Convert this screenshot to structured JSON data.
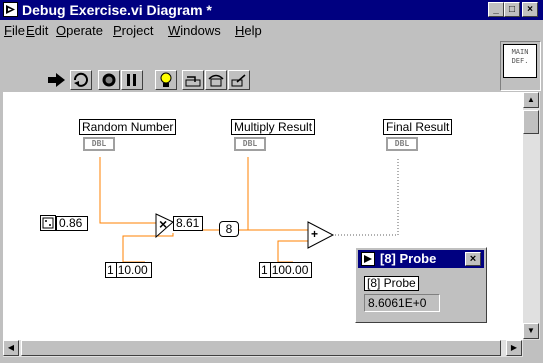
{
  "window": {
    "title": "Debug Exercise.vi Diagram *",
    "controls": {
      "minimize": "_",
      "maximize": "□",
      "close": "×"
    }
  },
  "menu": {
    "items": [
      {
        "label_u": "F",
        "label_rest": "ile"
      },
      {
        "label_u": "E",
        "label_rest": "dit"
      },
      {
        "label_u": "O",
        "label_rest": "perate"
      },
      {
        "label_u": "P",
        "label_rest": "roject"
      },
      {
        "label_u": "W",
        "label_rest": "indows"
      },
      {
        "label_u": "H",
        "label_rest": "elp"
      }
    ]
  },
  "toolbar": {
    "icons": [
      "run-arrow-icon",
      "run-continuously-icon",
      "abort-icon",
      "pause-icon",
      "highlight-execution-icon",
      "step-into-icon",
      "step-over-icon",
      "step-out-icon"
    ]
  },
  "main_icon": {
    "line1": "MAIN",
    "line2": "DEF."
  },
  "diagram": {
    "random_number_label": "Random Number",
    "multiply_result_label": "Multiply Result",
    "final_result_label": "Final Result",
    "dbl_tag": "DBL",
    "random_value": "0.86",
    "multiply_value": "8.61",
    "probe_tag": "8",
    "const1_unit": "1",
    "const1_value": "10.00",
    "const2_unit": "1",
    "const2_value": "100.00",
    "multiply_symbol": "×",
    "add_symbol": "+"
  },
  "probe": {
    "title": "[8] Probe",
    "label": "[8] Probe",
    "value": "8.6061E+0",
    "close": "×"
  },
  "colors": {
    "titlebar": "#000080",
    "window_face": "#c0c0c0",
    "canvas": "#ffffff"
  }
}
